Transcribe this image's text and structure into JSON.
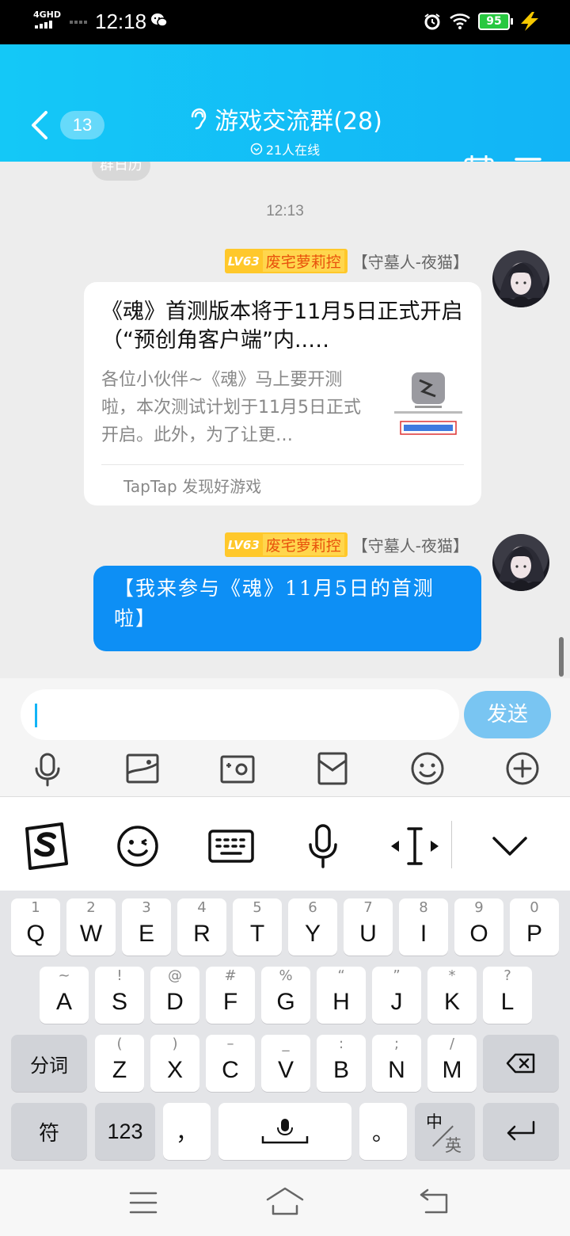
{
  "status_bar": {
    "network": "4GHD",
    "time": "12:18",
    "battery": "95",
    "icons": [
      "signal-icon",
      "wechat-icon",
      "alarm-icon",
      "wifi-icon",
      "battery-icon",
      "charging-icon"
    ]
  },
  "header": {
    "back_badge": "13",
    "title": "游戏交流群(28)",
    "online": "21人在线",
    "colors": {
      "gradient_start": "#14c8f7",
      "gradient_end": "#12b4f6"
    }
  },
  "chat": {
    "calendar_chip": "群日历",
    "timestamp": "12:13",
    "messages": [
      {
        "level": "LV63",
        "nickname": "废宅萝莉控",
        "title_tag": "【守墓人-夜猫】",
        "type": "share-card",
        "card_title": "《魂》首测版本将于11月5日正式开启（“预创角客户端”内..…",
        "card_desc": "各位小伙伴~《魂》马上要开测啦，本次测试计划于11月5日正式开启。此外，为了让更…",
        "card_source": "TapTap 发现好游戏"
      },
      {
        "level": "LV63",
        "nickname": "废宅萝莉控",
        "title_tag": "【守墓人-夜猫】",
        "type": "text",
        "text": "【我来参与《魂》11月5日的首测啦】"
      }
    ]
  },
  "input_bar": {
    "placeholder": "",
    "send_label": "发送",
    "tools": [
      "voice-icon",
      "image-icon",
      "camera-icon",
      "red-packet-icon",
      "emoji-icon",
      "plus-icon"
    ]
  },
  "ime_toolbar": [
    "sogou-logo-icon",
    "emoji-icon",
    "keyboard-icon",
    "mic-icon",
    "cursor-move-icon",
    "collapse-icon"
  ],
  "keyboard": {
    "row1": [
      {
        "hint": "1",
        "key": "Q"
      },
      {
        "hint": "2",
        "key": "W"
      },
      {
        "hint": "3",
        "key": "E"
      },
      {
        "hint": "4",
        "key": "R"
      },
      {
        "hint": "5",
        "key": "T"
      },
      {
        "hint": "6",
        "key": "Y"
      },
      {
        "hint": "7",
        "key": "U"
      },
      {
        "hint": "8",
        "key": "I"
      },
      {
        "hint": "9",
        "key": "O"
      },
      {
        "hint": "0",
        "key": "P"
      }
    ],
    "row2": [
      {
        "hint": "~",
        "key": "A"
      },
      {
        "hint": "!",
        "key": "S"
      },
      {
        "hint": "@",
        "key": "D"
      },
      {
        "hint": "#",
        "key": "F"
      },
      {
        "hint": "%",
        "key": "G"
      },
      {
        "hint": "“",
        "key": "H"
      },
      {
        "hint": "”",
        "key": "J"
      },
      {
        "hint": "*",
        "key": "K"
      },
      {
        "hint": "?",
        "key": "L"
      }
    ],
    "row3": [
      {
        "hint": "(",
        "key": "Z"
      },
      {
        "hint": ")",
        "key": "X"
      },
      {
        "hint": "–",
        "key": "C"
      },
      {
        "hint": "_",
        "key": "V"
      },
      {
        "hint": ":",
        "key": "B"
      },
      {
        "hint": ";",
        "key": "N"
      },
      {
        "hint": "/",
        "key": "M"
      }
    ],
    "fenci": "分词",
    "fu": "符",
    "num": "123",
    "comma": "，",
    "period": "。",
    "lang_zh": "中",
    "lang_en": "英"
  },
  "nav_bar": [
    "menu-icon",
    "home-icon",
    "back-icon"
  ]
}
